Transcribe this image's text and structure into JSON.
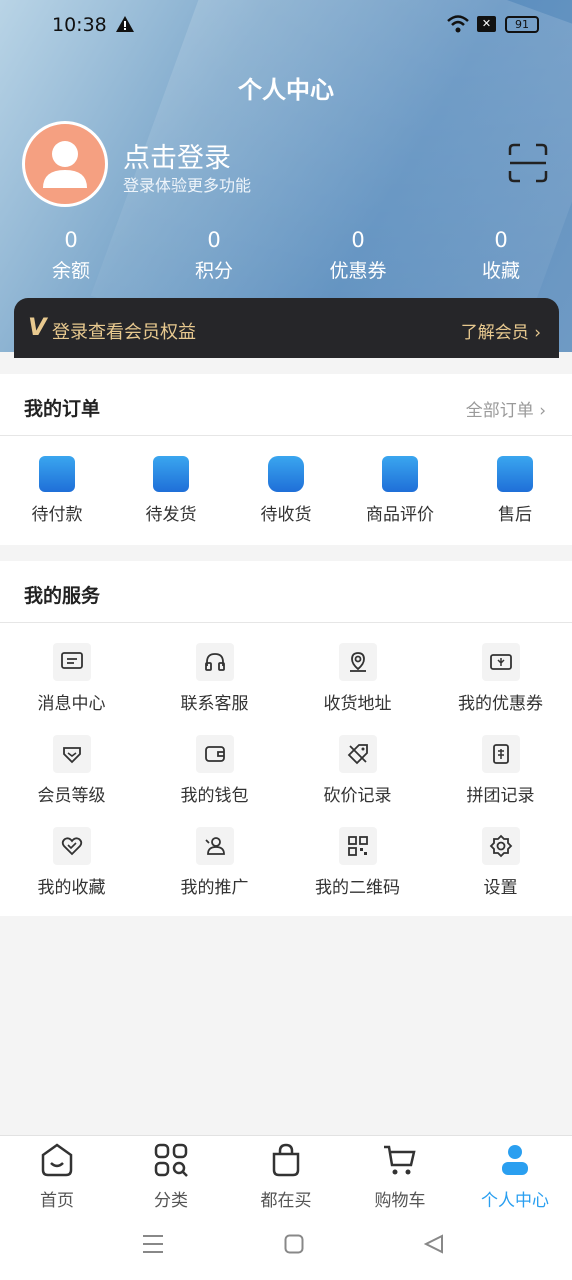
{
  "status": {
    "time": "10:38",
    "x_label": "✕",
    "battery": "91"
  },
  "header": {
    "title": "个人中心"
  },
  "profile": {
    "title": "点击登录",
    "subtitle": "登录体验更多功能"
  },
  "stats": [
    {
      "value": "0",
      "label": "余额"
    },
    {
      "value": "0",
      "label": "积分"
    },
    {
      "value": "0",
      "label": "优惠券"
    },
    {
      "value": "0",
      "label": "收藏"
    }
  ],
  "vip": {
    "badge": "V",
    "text": "登录查看会员权益",
    "more": "了解会员"
  },
  "orders": {
    "title": "我的订单",
    "all": "全部订单",
    "items": [
      {
        "label": "待付款",
        "icon": "wallet-icon"
      },
      {
        "label": "待发货",
        "icon": "box-icon"
      },
      {
        "label": "待收货",
        "icon": "truck-icon"
      },
      {
        "label": "商品评价",
        "icon": "heart-comment-icon"
      },
      {
        "label": "售后",
        "icon": "return-icon"
      }
    ]
  },
  "services": {
    "title": "我的服务",
    "items": [
      {
        "label": "消息中心"
      },
      {
        "label": "联系客服"
      },
      {
        "label": "收货地址"
      },
      {
        "label": "我的优惠券"
      },
      {
        "label": "会员等级"
      },
      {
        "label": "我的钱包"
      },
      {
        "label": "砍价记录"
      },
      {
        "label": "拼团记录"
      },
      {
        "label": "我的收藏"
      },
      {
        "label": "我的推广"
      },
      {
        "label": "我的二维码"
      },
      {
        "label": "设置"
      }
    ]
  },
  "tabs": [
    {
      "label": "首页"
    },
    {
      "label": "分类"
    },
    {
      "label": "都在买"
    },
    {
      "label": "购物车"
    },
    {
      "label": "个人中心"
    }
  ],
  "colors": {
    "accent": "#2a9ff0",
    "gold": "#e8c98f",
    "avatar": "#f5a081"
  }
}
